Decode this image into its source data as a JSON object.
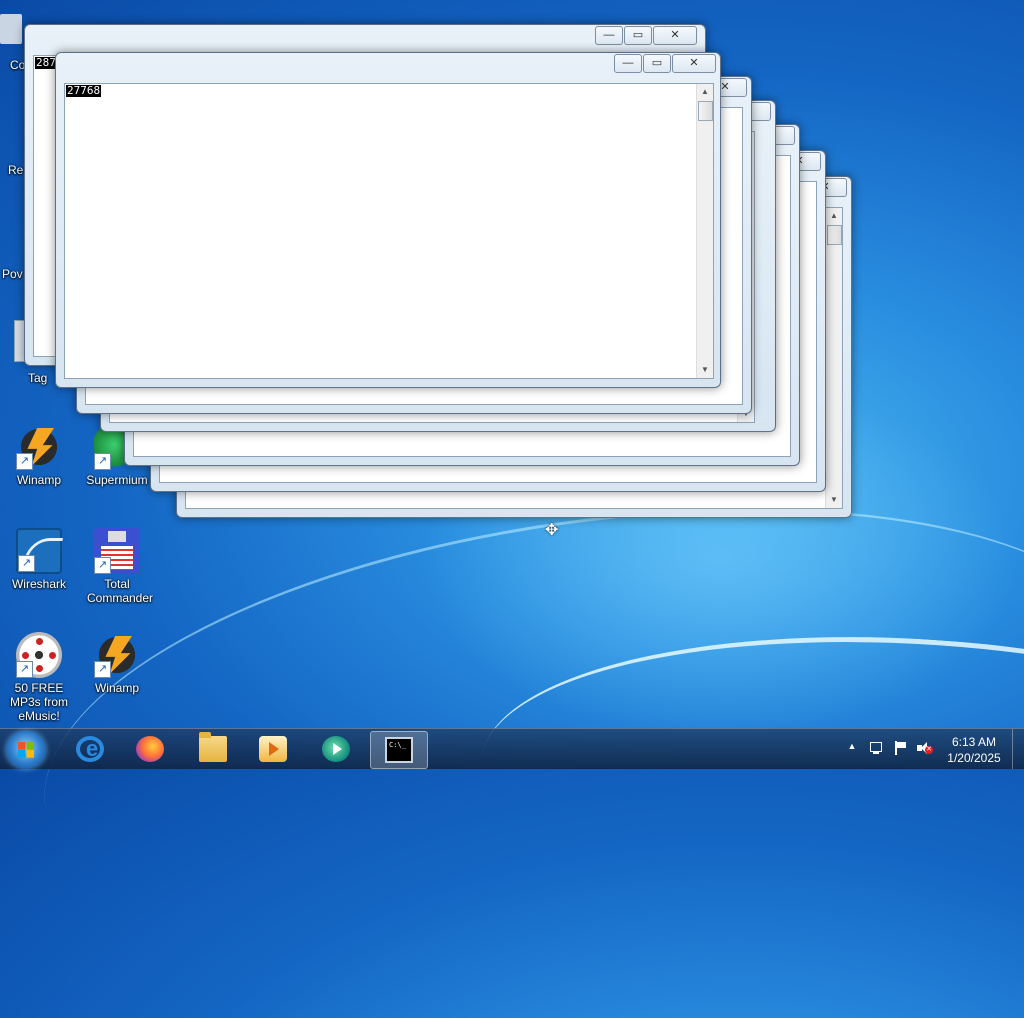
{
  "desktop": {
    "icons": [
      {
        "label": "Winamp",
        "kind": "winamp"
      },
      {
        "label": "Supermium",
        "kind": "supermium"
      },
      {
        "label": "Wireshark",
        "kind": "wireshark"
      },
      {
        "label": "Total Commander",
        "kind": "total-commander"
      },
      {
        "label": "50 FREE MP3s from eMusic!",
        "kind": "emusic"
      },
      {
        "label": "Winamp",
        "kind": "winamp"
      }
    ],
    "partial_labels": [
      "Co",
      "Re",
      "Pov",
      "Tag"
    ]
  },
  "windows": {
    "back_console_value": "28758",
    "front_console_value": "27768",
    "ghost_console_value": "27768",
    "min_glyph": "—",
    "max_glyph": "▭",
    "close_glyph": "✕"
  },
  "taskbar": {
    "start_label": "Start",
    "pinned": [
      "internet-explorer",
      "firefox",
      "file-explorer",
      "windows-media-player",
      "media-center",
      "command-prompt"
    ],
    "active": "command-prompt",
    "tray_overflow": "▲",
    "time": "6:13 AM",
    "date": "1/20/2025"
  },
  "colors": {
    "desktop_blue": "#1466c4",
    "window_frame": "#d7e5f1",
    "console_bg": "#000000"
  }
}
